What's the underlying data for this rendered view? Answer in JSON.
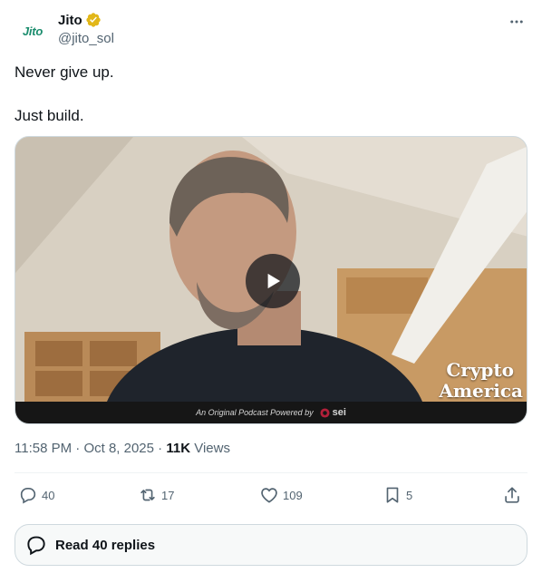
{
  "colors": {
    "accent_green": "#1c8d6e",
    "verified_gold": "#e2b719",
    "muted": "#536471",
    "text": "#0f1419"
  },
  "author": {
    "avatar_text": "Jito",
    "display_name": "Jito",
    "handle": "@jito_sol",
    "verified_icon": "verified-gold-badge-icon",
    "more_icon": "more-horizontal-icon"
  },
  "tweet": {
    "lines": [
      "Never give up.",
      "Just build."
    ]
  },
  "media": {
    "type": "video",
    "play_icon": "play-icon",
    "brand_line1": "Crypto",
    "brand_line2": "America",
    "caption": "An Original Podcast Powered by",
    "sponsor": "sei"
  },
  "meta": {
    "time": "11:58 PM",
    "date": "Oct 8, 2025",
    "views_count": "11K",
    "views_label": "Views"
  },
  "actions": {
    "reply_count": "40",
    "repost_count": "17",
    "like_count": "109",
    "bookmark_count": "5",
    "icons": [
      "reply-icon",
      "repost-icon",
      "like-icon",
      "bookmark-icon",
      "share-icon"
    ]
  },
  "replies": {
    "label": "Read 40 replies"
  }
}
